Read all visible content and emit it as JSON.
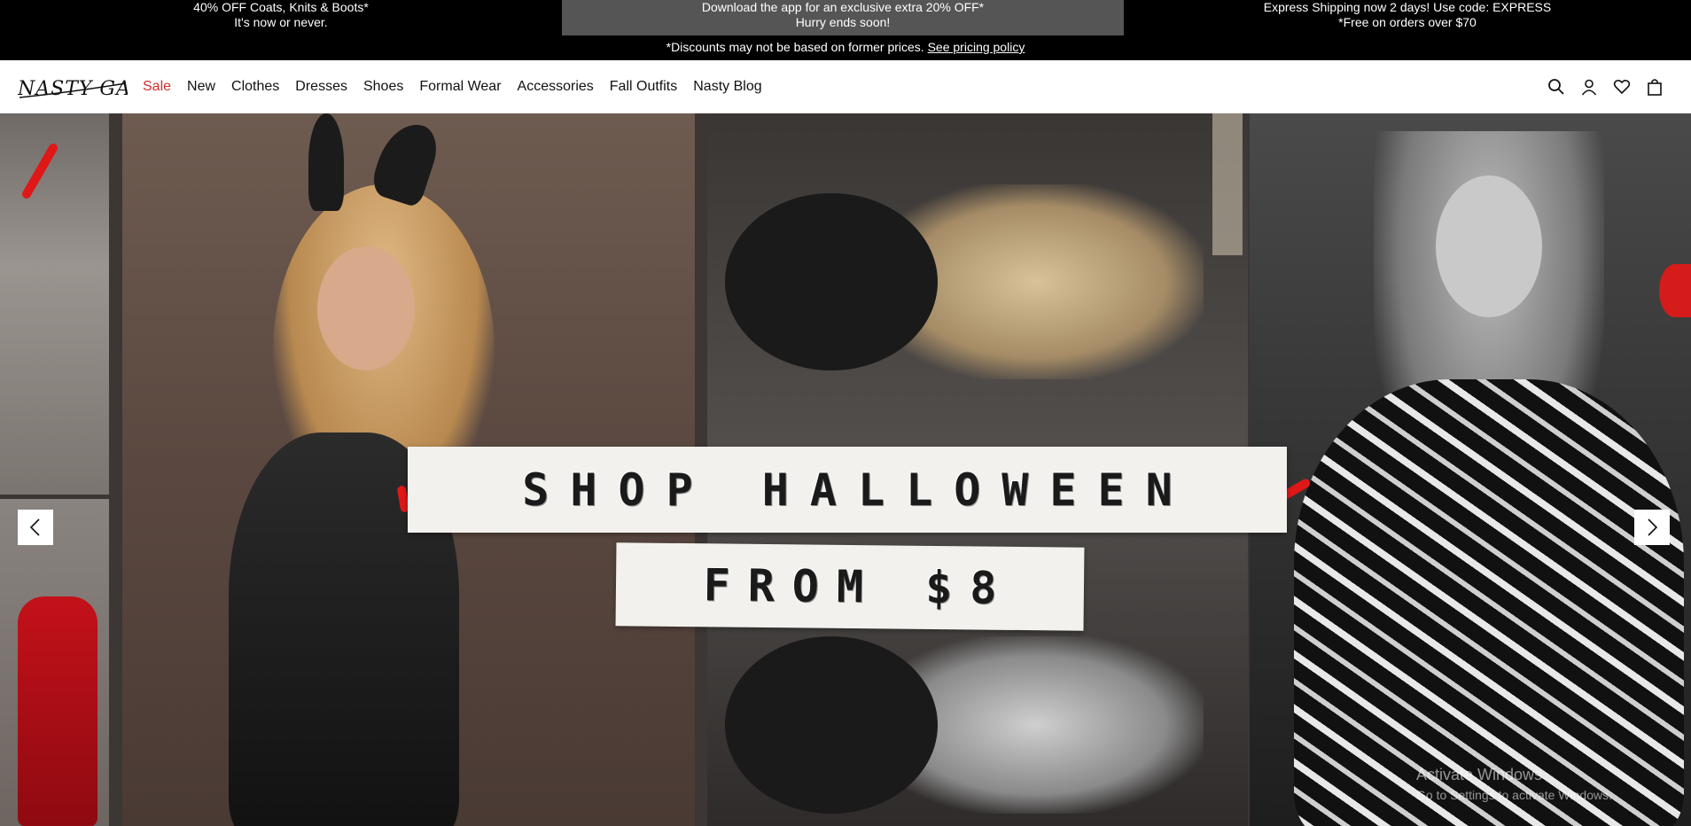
{
  "promo_bar": {
    "left": {
      "line1": "40% OFF Coats, Knits & Boots*",
      "line2": "It's now or never."
    },
    "center": {
      "line1": "Download the app for an exclusive extra 20% OFF*",
      "line2": "Hurry ends soon!"
    },
    "right": {
      "line1": "Express Shipping now 2 days! Use code: EXPRESS",
      "line2": "*Free on orders over $70"
    },
    "note": "*Discounts may not be based on former prices.",
    "note_link": "See pricing policy"
  },
  "header": {
    "logo_text": "NASTY GAL",
    "nav": [
      {
        "label": "Sale"
      },
      {
        "label": "New"
      },
      {
        "label": "Clothes"
      },
      {
        "label": "Dresses"
      },
      {
        "label": "Shoes"
      },
      {
        "label": "Formal Wear"
      },
      {
        "label": "Accessories"
      },
      {
        "label": "Fall Outfits"
      },
      {
        "label": "Nasty Blog"
      }
    ],
    "icons": [
      "search-icon",
      "account-icon",
      "wishlist-heart-icon",
      "shopping-bag-icon"
    ]
  },
  "hero": {
    "headline_line1": "SHOP HALLOWEEN",
    "headline_line2": "FROM $8",
    "prev_label": "‹",
    "next_label": "›"
  },
  "watermark": {
    "title": "Activate Windows",
    "subtitle": "Go to Settings to activate Windows."
  },
  "colors": {
    "sale": "#d22d2d",
    "promo_bg": "#000000",
    "promo_highlight": "#555555"
  }
}
